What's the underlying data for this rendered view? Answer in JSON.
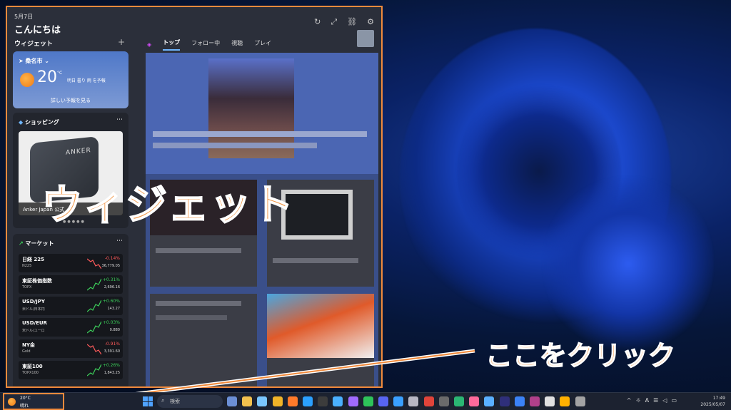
{
  "panel": {
    "date": "5月7日",
    "greeting": "こんにちは",
    "widgets_label": "ウィジェット",
    "tabs": [
      {
        "label": "トップ",
        "active": true
      },
      {
        "label": "フォロー中"
      },
      {
        "label": "視聴"
      },
      {
        "label": "プレイ"
      }
    ]
  },
  "weather": {
    "location": "桑名市",
    "temp": "20",
    "unit": "°C",
    "note": "明日 曇り 雨 を予報",
    "forecast_button": "詳しい予報を見る"
  },
  "shopping": {
    "title": "ショッピング",
    "product_brand": "ANKER",
    "caption": "Anker Japan 公式"
  },
  "market": {
    "title": "マーケット",
    "items": [
      {
        "name": "日経 225",
        "sub": "N225",
        "change": "-0.14%",
        "value": "36,779.05",
        "up": false
      },
      {
        "name": "東証株価指数",
        "sub": "TOPX",
        "change": "+0.31%",
        "value": "2,696.16",
        "up": true
      },
      {
        "name": "USD/JPY",
        "sub": "米ドル/日本円",
        "change": "+0.60%",
        "value": "143.27",
        "up": true
      },
      {
        "name": "USD/EUR",
        "sub": "米ドル/ユーロ",
        "change": "+0.03%",
        "value": "0.880",
        "up": true
      },
      {
        "name": "NY金",
        "sub": "Gold",
        "change": "-0.91%",
        "value": "3,391.60",
        "up": false
      },
      {
        "name": "東証100",
        "sub": "TOPX100",
        "change": "+0.26%",
        "value": "1,843.25",
        "up": true
      }
    ]
  },
  "overlay": {
    "widget_caption": "ウィジェット",
    "click_caption": "ここをクリック"
  },
  "taskbar": {
    "weather_temp": "20°C",
    "weather_cond": "晴れ",
    "search_placeholder": "検索",
    "time": "17:49",
    "date": "2025/05/07"
  },
  "colors": {
    "accent": "#f08a3c",
    "up": "#3ccf5a",
    "down": "#ff5a5a"
  }
}
